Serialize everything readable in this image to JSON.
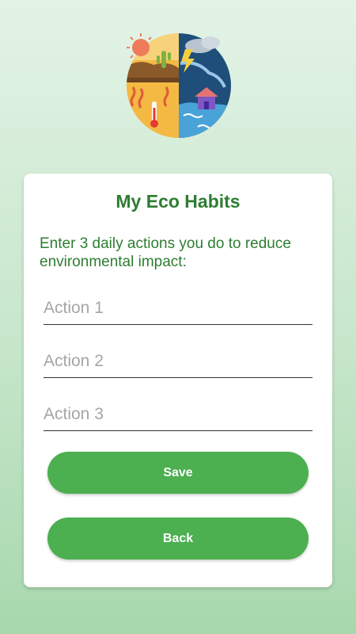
{
  "header": {
    "logo_icon": "climate-change-globe-icon"
  },
  "card": {
    "title": "My Eco Habits",
    "instructions": "Enter 3 daily actions you do to reduce environmental impact:",
    "fields": [
      {
        "placeholder": "Action 1",
        "value": ""
      },
      {
        "placeholder": "Action 2",
        "value": ""
      },
      {
        "placeholder": "Action 3",
        "value": ""
      }
    ],
    "save_label": "Save",
    "back_label": "Back"
  },
  "colors": {
    "accent": "#4caf50",
    "title": "#2e7d32",
    "background_top": "#e3f3e6",
    "background_bottom": "#a7d8ad"
  }
}
